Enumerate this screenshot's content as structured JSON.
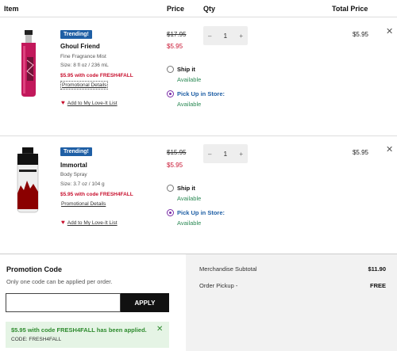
{
  "header": {
    "item": "Item",
    "price": "Price",
    "qty": "Qty",
    "total_price": "Total Price"
  },
  "items": [
    {
      "badge": "Trending!",
      "name": "Ghoul Friend",
      "type": "Fine Fragrance Mist",
      "size": "Size: 8 fl oz / 236 mL",
      "promo": "$5.95 with code FRESH4FALL",
      "details": "Promotional Details",
      "love": "Add to My Love-It List",
      "orig_price": "$17.95",
      "sale_price": "$5.95",
      "quantity": "1",
      "total": "$5.95",
      "ship_label": "Ship it",
      "ship_avail": "Available",
      "pickup_label": "Pick Up in Store:",
      "pickup_avail": "Available",
      "selected": "pickup",
      "image_icon": "pink-spray-bottle-icon"
    },
    {
      "badge": "Trending!",
      "name": "Immortal",
      "type": "Body Spray",
      "size": "Size: 3.7 oz / 104 g",
      "promo": "$5.95 with code FRESH4FALL",
      "details": "Promotional Details",
      "love": "Add to My Love-It List",
      "orig_price": "$15.95",
      "sale_price": "$5.95",
      "quantity": "1",
      "total": "$5.95",
      "ship_label": "Ship it",
      "ship_avail": "Available",
      "pickup_label": "Pick Up in Store:",
      "pickup_avail": "Available",
      "selected": "pickup",
      "image_icon": "black-body-spray-can-icon"
    }
  ],
  "qty_controls": {
    "minus": "–",
    "plus": "+"
  },
  "close_glyph": "✕",
  "promotion": {
    "title": "Promotion Code",
    "subtitle": "Only one code can be applied per order.",
    "input_value": "",
    "apply_label": "APPLY",
    "applied_message": "$5.95 with code FRESH4FALL has been applied.",
    "applied_code": "CODE: FRESH4FALL"
  },
  "summary": {
    "subtotal_label": "Merchandise Subtotal",
    "subtotal_value": "$11.90",
    "pickup_label": "Order Pickup -",
    "pickup_value": "FREE"
  },
  "colors": {
    "badge_blue": "#1f5fa5",
    "promo_red": "#c8102e",
    "available_green": "#2e8b57",
    "radio_purple": "#7a2ca8",
    "applied_bg": "#e5f4e5"
  }
}
